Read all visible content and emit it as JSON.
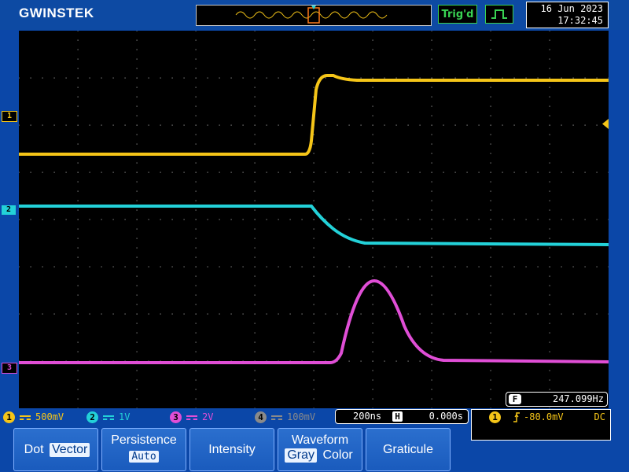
{
  "header": {
    "brand": "GWINSTEK",
    "trigger_status": "Trig'd",
    "date": "16 Jun 2023",
    "time": "17:32:45"
  },
  "channels": [
    {
      "id": "1",
      "color": "#f5c518",
      "scale": "500mV"
    },
    {
      "id": "2",
      "color": "#23d1d8",
      "scale": "1V"
    },
    {
      "id": "3",
      "color": "#e04ed6",
      "scale": "2V"
    },
    {
      "id": "4",
      "color": "#8a8a8a",
      "scale": "100mV"
    }
  ],
  "markers": {
    "ch1": "1",
    "ch2": "2",
    "ch3": "3"
  },
  "frequency": {
    "label": "F",
    "value": "247.099Hz"
  },
  "timebase": {
    "scale": "200ns",
    "icon": "H",
    "position": "0.000s"
  },
  "trigger": {
    "source": "1",
    "level": "-80.0mV",
    "coupling": "DC",
    "slope_icon": "rising-edge-icon"
  },
  "softkeys": {
    "dot_vector": {
      "left": "Dot",
      "right": "Vector",
      "selected": "Vector"
    },
    "persistence": {
      "title": "Persistence",
      "value": "Auto"
    },
    "intensity": {
      "title": "Intensity"
    },
    "waveform": {
      "title": "Waveform",
      "left": "Gray",
      "right": "Color",
      "selected": "Gray"
    },
    "graticule": {
      "title": "Graticule"
    }
  },
  "colors": {
    "background": "#0b47a8",
    "screen": "#000000",
    "grid": "#777777",
    "accent_green": "#39d353"
  }
}
